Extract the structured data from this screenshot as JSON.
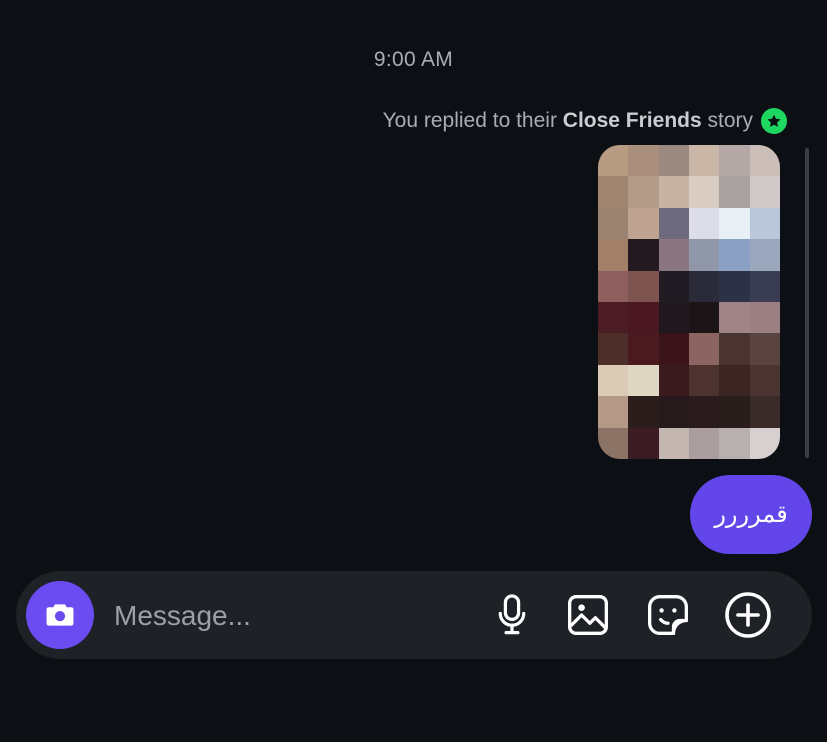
{
  "thread": {
    "timestamp": "9:00 AM",
    "reply_prefix": "You replied to their ",
    "reply_bold": "Close Friends",
    "reply_suffix": " story",
    "outgoing_message": "قمرررر"
  },
  "composer": {
    "placeholder": "Message..."
  },
  "colors": {
    "background": "#0c1014",
    "accent": "#6246ea",
    "close_friends_badge": "#1ed760",
    "composer_bg": "#1e2226"
  },
  "icons": [
    "star-icon",
    "camera-icon",
    "microphone-icon",
    "image-icon",
    "sticker-icon",
    "plus-icon"
  ]
}
